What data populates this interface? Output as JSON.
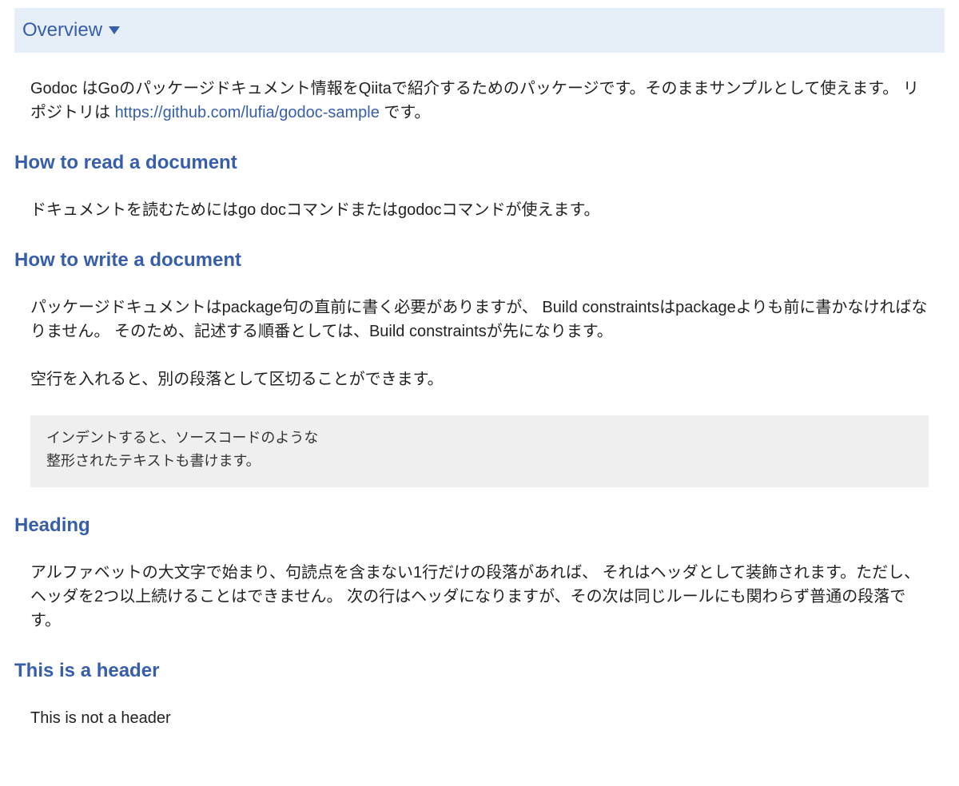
{
  "header": {
    "overview_label": "Overview"
  },
  "intro": {
    "text_before_link": "Godoc はGoのパッケージドキュメント情報をQiitaで紹介するためのパッケージです。そのままサンプルとして使えます。 リポジトリは ",
    "link_text": "https://github.com/lufia/godoc-sample",
    "text_after_link": " です。"
  },
  "sections": {
    "read": {
      "title": "How to read a document",
      "para": "ドキュメントを読むためにはgo docコマンドまたはgodocコマンドが使えます。"
    },
    "write": {
      "title": "How to write a document",
      "para1": "パッケージドキュメントはpackage句の直前に書く必要がありますが、 Build constraintsはpackageよりも前に書かなければなりません。 そのため、記述する順番としては、Build constraintsが先になります。",
      "para2": "空行を入れると、別の段落として区切ることができます。",
      "code": "インデントすると、ソースコードのような\n整形されたテキストも書けます。"
    },
    "heading": {
      "title": "Heading",
      "para": "アルファベットの大文字で始まり、句読点を含まない1行だけの段落があれば、 それはヘッダとして装飾されます。ただし、ヘッダを2つ以上続けることはできません。 次の行はヘッダになりますが、その次は同じルールにも関わらず普通の段落です。"
    },
    "this_header": {
      "title": "This is a header",
      "para": "This is not a header"
    }
  }
}
